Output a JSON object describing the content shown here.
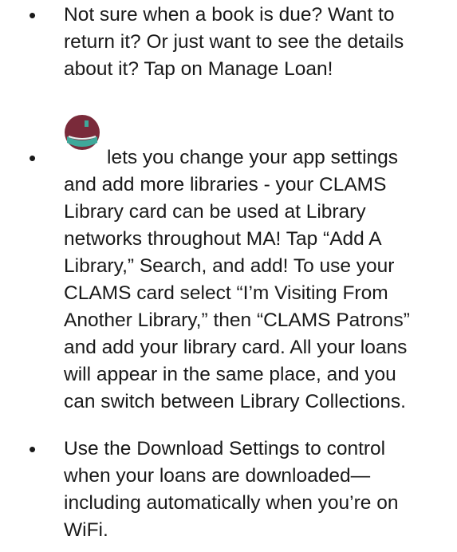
{
  "bullets": [
    {
      "lines": [
        "Not sure when a book is due?  Want to",
        "return it?  Or just want to see the details",
        "about it?  Tap on Manage Loan!"
      ]
    },
    {
      "icon": "library-app-icon",
      "lines": [
        "lets you change your app settings",
        "and add more libraries - your CLAMS",
        "Library card can be used at Library",
        "networks throughout MA!  Tap “Add A",
        "Library,” Search, and add!  To use your",
        "CLAMS card select “I’m Visiting From",
        "Another Library,” then “CLAMS Patrons”",
        "and add your library card.  All your loans",
        "will appear in the same place, and you",
        "can switch between Library Collections."
      ]
    },
    {
      "lines": [
        "Use the Download Settings to control",
        "when your loans are downloaded—",
        "including automatically when you’re on",
        "WiFi."
      ]
    }
  ],
  "bullet_glyph": "•",
  "colors": {
    "text": "#1a1a1a",
    "icon_body": "#7a2a3a",
    "icon_book": "#3fa89a"
  }
}
